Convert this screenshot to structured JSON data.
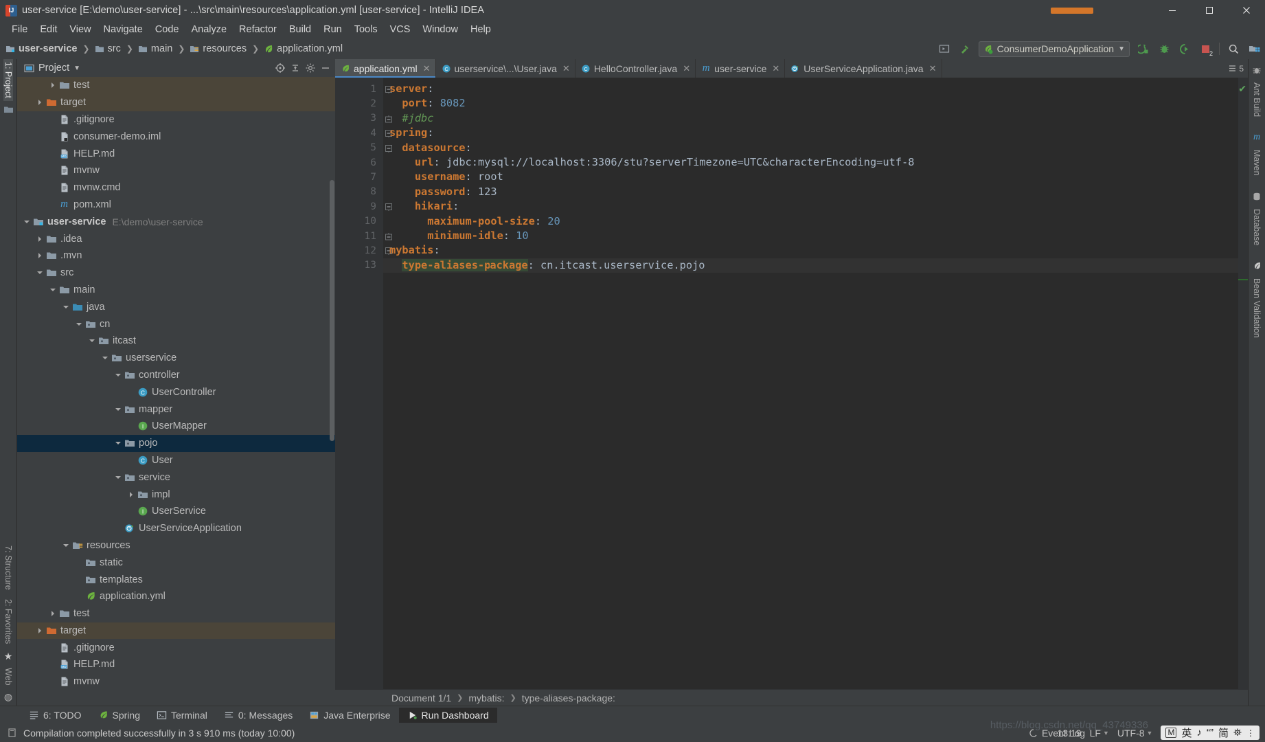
{
  "window": {
    "title": "user-service [E:\\demo\\user-service] - ...\\src\\main\\resources\\application.yml [user-service] - IntelliJ IDEA",
    "minimize_label": "—",
    "maximize_label": "❐",
    "close_label": "✕"
  },
  "menubar": {
    "items": [
      "File",
      "Edit",
      "View",
      "Navigate",
      "Code",
      "Analyze",
      "Refactor",
      "Build",
      "Run",
      "Tools",
      "VCS",
      "Window",
      "Help"
    ]
  },
  "navbar": {
    "breadcrumb": [
      "user-service",
      "src",
      "main",
      "resources",
      "application.yml"
    ],
    "run_config": "ConsumerDemoApplication",
    "stop_badge": "2"
  },
  "left_strip": {
    "top": [
      "1: Project"
    ],
    "bottom": [
      "7: Structure",
      "2: Favorites",
      "Web"
    ]
  },
  "right_strip": {
    "items": [
      "Ant Build",
      "Maven",
      "Database",
      "Bean Validation"
    ]
  },
  "project_panel": {
    "title": "Project",
    "tree": [
      {
        "label": "test",
        "indent": 3,
        "arrow": "collapsed",
        "icon": "folder-test",
        "state": "hl-top"
      },
      {
        "label": "target",
        "indent": 2,
        "arrow": "collapsed",
        "icon": "folder-target",
        "state": "hl"
      },
      {
        "label": ".gitignore",
        "indent": 3,
        "arrow": "none",
        "icon": "file-text",
        "state": ""
      },
      {
        "label": "consumer-demo.iml",
        "indent": 3,
        "arrow": "none",
        "icon": "file-iml",
        "state": ""
      },
      {
        "label": "HELP.md",
        "indent": 3,
        "arrow": "none",
        "icon": "file-md",
        "state": ""
      },
      {
        "label": "mvnw",
        "indent": 3,
        "arrow": "none",
        "icon": "file-text",
        "state": ""
      },
      {
        "label": "mvnw.cmd",
        "indent": 3,
        "arrow": "none",
        "icon": "file-text",
        "state": ""
      },
      {
        "label": "pom.xml",
        "indent": 3,
        "arrow": "none",
        "icon": "file-maven",
        "state": ""
      },
      {
        "label": "user-service",
        "indent": 1,
        "arrow": "expanded",
        "icon": "module",
        "state": "",
        "bold": true,
        "path": "E:\\demo\\user-service"
      },
      {
        "label": ".idea",
        "indent": 2,
        "arrow": "collapsed",
        "icon": "folder",
        "state": ""
      },
      {
        "label": ".mvn",
        "indent": 2,
        "arrow": "collapsed",
        "icon": "folder",
        "state": ""
      },
      {
        "label": "src",
        "indent": 2,
        "arrow": "expanded",
        "icon": "folder",
        "state": ""
      },
      {
        "label": "main",
        "indent": 3,
        "arrow": "expanded",
        "icon": "folder",
        "state": ""
      },
      {
        "label": "java",
        "indent": 4,
        "arrow": "expanded",
        "icon": "folder-source",
        "state": ""
      },
      {
        "label": "cn",
        "indent": 5,
        "arrow": "expanded",
        "icon": "package",
        "state": ""
      },
      {
        "label": "itcast",
        "indent": 6,
        "arrow": "expanded",
        "icon": "package",
        "state": ""
      },
      {
        "label": "userservice",
        "indent": 7,
        "arrow": "expanded",
        "icon": "package",
        "state": ""
      },
      {
        "label": "controller",
        "indent": 8,
        "arrow": "expanded",
        "icon": "package",
        "state": ""
      },
      {
        "label": "UserController",
        "indent": 9,
        "arrow": "none",
        "icon": "class",
        "state": ""
      },
      {
        "label": "mapper",
        "indent": 8,
        "arrow": "expanded",
        "icon": "package",
        "state": ""
      },
      {
        "label": "UserMapper",
        "indent": 9,
        "arrow": "none",
        "icon": "interface",
        "state": ""
      },
      {
        "label": "pojo",
        "indent": 8,
        "arrow": "expanded",
        "icon": "package",
        "state": "sel"
      },
      {
        "label": "User",
        "indent": 9,
        "arrow": "none",
        "icon": "class",
        "state": ""
      },
      {
        "label": "service",
        "indent": 8,
        "arrow": "expanded",
        "icon": "package",
        "state": ""
      },
      {
        "label": "impl",
        "indent": 9,
        "arrow": "collapsed",
        "icon": "package",
        "state": ""
      },
      {
        "label": "UserService",
        "indent": 9,
        "arrow": "none",
        "icon": "interface",
        "state": ""
      },
      {
        "label": "UserServiceApplication",
        "indent": 8,
        "arrow": "none",
        "icon": "spring-run",
        "state": ""
      },
      {
        "label": "resources",
        "indent": 4,
        "arrow": "expanded",
        "icon": "folder-res",
        "state": ""
      },
      {
        "label": "static",
        "indent": 5,
        "arrow": "none",
        "icon": "package",
        "state": ""
      },
      {
        "label": "templates",
        "indent": 5,
        "arrow": "none",
        "icon": "package",
        "state": ""
      },
      {
        "label": "application.yml",
        "indent": 5,
        "arrow": "none",
        "icon": "spring-leaf",
        "state": ""
      },
      {
        "label": "test",
        "indent": 3,
        "arrow": "collapsed",
        "icon": "folder-test",
        "state": ""
      },
      {
        "label": "target",
        "indent": 2,
        "arrow": "collapsed",
        "icon": "folder-target",
        "state": "hl"
      },
      {
        "label": ".gitignore",
        "indent": 3,
        "arrow": "none",
        "icon": "file-text",
        "state": ""
      },
      {
        "label": "HELP.md",
        "indent": 3,
        "arrow": "none",
        "icon": "file-md",
        "state": ""
      },
      {
        "label": "mvnw",
        "indent": 3,
        "arrow": "none",
        "icon": "file-text",
        "state": ""
      }
    ]
  },
  "editor": {
    "tabs": [
      {
        "label": "application.yml",
        "icon": "spring-leaf",
        "active": true
      },
      {
        "label": "userservice\\...\\User.java",
        "icon": "class",
        "active": false
      },
      {
        "label": "HelloController.java",
        "icon": "class",
        "active": false
      },
      {
        "label": "user-service",
        "icon": "maven",
        "active": false
      },
      {
        "label": "UserServiceApplication.java",
        "icon": "spring-run",
        "active": false
      }
    ],
    "tab_overflow": "5",
    "lines": [
      {
        "num": "1",
        "fold": "start",
        "segments": [
          {
            "t": "server",
            "c": "k"
          },
          {
            "t": ":",
            "c": "p"
          }
        ]
      },
      {
        "num": "2",
        "fold": "none",
        "segments": [
          {
            "t": "  ",
            "c": "p"
          },
          {
            "t": "port",
            "c": "k"
          },
          {
            "t": ": ",
            "c": "p"
          },
          {
            "t": "8082",
            "c": "n"
          }
        ]
      },
      {
        "num": "3",
        "fold": "end",
        "segments": [
          {
            "t": "  ",
            "c": "p"
          },
          {
            "t": "#jdbc",
            "c": "cm"
          }
        ]
      },
      {
        "num": "4",
        "fold": "start",
        "segments": [
          {
            "t": "spring",
            "c": "k"
          },
          {
            "t": ":",
            "c": "p"
          }
        ]
      },
      {
        "num": "5",
        "fold": "start",
        "segments": [
          {
            "t": "  ",
            "c": "p"
          },
          {
            "t": "datasource",
            "c": "k"
          },
          {
            "t": ":",
            "c": "p"
          }
        ]
      },
      {
        "num": "6",
        "fold": "none",
        "segments": [
          {
            "t": "    ",
            "c": "p"
          },
          {
            "t": "url",
            "c": "k"
          },
          {
            "t": ": ",
            "c": "p"
          },
          {
            "t": "jdbc:mysql://localhost:3306/stu?serverTimezone=UTC&characterEncoding=utf-8",
            "c": "s"
          }
        ]
      },
      {
        "num": "7",
        "fold": "none",
        "segments": [
          {
            "t": "    ",
            "c": "p"
          },
          {
            "t": "username",
            "c": "k"
          },
          {
            "t": ": ",
            "c": "p"
          },
          {
            "t": "root",
            "c": "s"
          }
        ]
      },
      {
        "num": "8",
        "fold": "none",
        "segments": [
          {
            "t": "    ",
            "c": "p"
          },
          {
            "t": "password",
            "c": "k"
          },
          {
            "t": ": ",
            "c": "p"
          },
          {
            "t": "123",
            "c": "s"
          }
        ]
      },
      {
        "num": "9",
        "fold": "start",
        "segments": [
          {
            "t": "    ",
            "c": "p"
          },
          {
            "t": "hikari",
            "c": "k"
          },
          {
            "t": ":",
            "c": "p"
          }
        ]
      },
      {
        "num": "10",
        "fold": "none",
        "segments": [
          {
            "t": "      ",
            "c": "p"
          },
          {
            "t": "maximum-pool-size",
            "c": "k"
          },
          {
            "t": ": ",
            "c": "p"
          },
          {
            "t": "20",
            "c": "n"
          }
        ]
      },
      {
        "num": "11",
        "fold": "end",
        "segments": [
          {
            "t": "      ",
            "c": "p"
          },
          {
            "t": "minimum-idle",
            "c": "k"
          },
          {
            "t": ": ",
            "c": "p"
          },
          {
            "t": "10",
            "c": "n"
          }
        ]
      },
      {
        "num": "12",
        "fold": "start",
        "segments": [
          {
            "t": "mybatis",
            "c": "k"
          },
          {
            "t": ":",
            "c": "p"
          }
        ]
      },
      {
        "num": "13",
        "fold": "end",
        "current": true,
        "segments": [
          {
            "t": "  ",
            "c": "p"
          },
          {
            "t": "type-aliases-p",
            "c": "k",
            "hl": "green"
          },
          {
            "t": "CARET",
            "c": "caret"
          },
          {
            "t": "ackage",
            "c": "k",
            "hl": "green"
          },
          {
            "t": ": ",
            "c": "p"
          },
          {
            "t": "cn.itcast.userservice.pojo",
            "c": "s"
          }
        ]
      }
    ],
    "breadcrumbs": [
      "Document 1/1",
      "mybatis:",
      "type-aliases-package:"
    ]
  },
  "tool_window_bar": {
    "items": [
      {
        "label": "6: TODO",
        "icon": "todo-icon",
        "active": false
      },
      {
        "label": "Spring",
        "icon": "spring-leaf",
        "active": false
      },
      {
        "label": "Terminal",
        "icon": "terminal",
        "active": false
      },
      {
        "label": "0: Messages",
        "icon": "messages",
        "active": false
      },
      {
        "label": "Java Enterprise",
        "icon": "jee",
        "active": false
      },
      {
        "label": "Run Dashboard",
        "icon": "run",
        "active": true
      }
    ]
  },
  "statusbar": {
    "message": "Compilation completed successfully in 3 s 910 ms (today 10:00)",
    "event_log": "Event Log",
    "caret_position": "13:19",
    "line_separator": "LF",
    "encoding": "UTF-8",
    "ime": {
      "mode": "M",
      "lang": "英",
      "note": "♪",
      "punct": "“”",
      "simplified": "简",
      "extra": "⛯",
      "chevron": "⋮"
    },
    "watermark": "https://blog.csdn.net/qq_43749336"
  },
  "colors": {
    "accent_blue": "#4a88c7",
    "selection_blue": "#0d293e",
    "keyword_orange": "#cc7832",
    "number_blue": "#6897bb",
    "comment_green": "#629755",
    "folder_orange": "#d2703a",
    "panel_bg": "#3c3f41",
    "editor_bg": "#2b2b2b"
  }
}
